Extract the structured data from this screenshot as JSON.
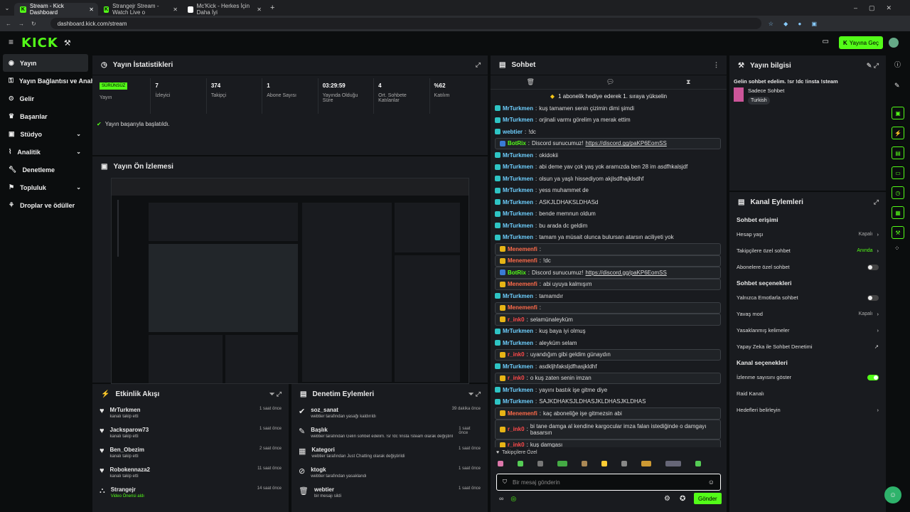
{
  "browser": {
    "tabs": [
      {
        "label": "Stream - Kick Dashboard"
      },
      {
        "label": "Strangejr Stream - Watch Live o"
      },
      {
        "label": "Mc'Kick - Herkes İçin Daha İyi"
      }
    ],
    "url": "dashboard.kick.com/stream"
  },
  "topnav": {
    "logo": "KICK",
    "go_live": "Yayına Geç"
  },
  "sidebar": {
    "items": [
      {
        "label": "Yayın"
      },
      {
        "label": "Yayın Bağlantısı ve Anahtar"
      },
      {
        "label": "Gelir"
      },
      {
        "label": "Başarılar"
      },
      {
        "label": "Stüdyo"
      },
      {
        "label": "Analitik"
      },
      {
        "label": "Denetleme"
      },
      {
        "label": "Topluluk"
      },
      {
        "label": "Droplar ve ödüller"
      }
    ]
  },
  "stats": {
    "title": "Yayın İstatistikleri",
    "badge": "SÜRÜNSÜZ",
    "badge_label": "Yayın",
    "items": [
      {
        "value": "7",
        "label": "İzleyici"
      },
      {
        "value": "374",
        "label": "Takipçi"
      },
      {
        "value": "1",
        "label": "Abone Sayısı"
      },
      {
        "value": "03:29:59",
        "label": "Yayında Olduğu Süre"
      },
      {
        "value": "4",
        "label": "Ort. Sohbete Katılanlar"
      },
      {
        "value": "%62",
        "label": "Katılım"
      }
    ],
    "success": "Yayın başarıyla başlatıldı."
  },
  "preview": {
    "title": "Yayın Ön İzlemesi"
  },
  "activity": {
    "title": "Etkinlik Akışı",
    "items": [
      {
        "name": "MrTurkmen",
        "sub": "kanalı takip etti",
        "time": "1 saat önce"
      },
      {
        "name": "Jacksparow73",
        "sub": "kanalı takip etti",
        "time": "1 saat önce"
      },
      {
        "name": "Ben_Obezim",
        "sub": "kanalı takip etti",
        "time": "2 saat önce"
      },
      {
        "name": "Robokennaza2",
        "sub": "kanalı takip etti",
        "time": "11 saat önce"
      },
      {
        "name": "Strangejr",
        "sub": "Video Önerisi aldı",
        "time": "14 saat önce"
      }
    ]
  },
  "moderation": {
    "title": "Denetim Eylemleri",
    "items": [
      {
        "name": "soz_sanat",
        "sub": "webtier tarafından yasağı kaldırıldı",
        "time": "39 dakika önce"
      },
      {
        "name": "Başlık",
        "sub": "webtier tarafından Gelin sohbet edelim. !sr !dc !insta !steam olarak değiştirildi",
        "time": "1 saat önce"
      },
      {
        "name": "Kategori",
        "sub": "webtier tarafından Just Chatting olarak değiştirildi",
        "time": "1 saat önce"
      },
      {
        "name": "ktogk",
        "sub": "webtier tarafından yasaklandı",
        "time": "1 saat önce"
      },
      {
        "name": "webtier",
        "sub": "bir mesajı sildi",
        "time": "1 saat önce"
      }
    ]
  },
  "chat": {
    "title": "Sohbet",
    "pinned": "1 abonelik hediye ederek 1. sıraya yükselin",
    "lines": [
      {
        "user": "MrTurkmen",
        "color": "#6fd0ff",
        "text": "kuş tamamen senin çizimin dimi şimdi",
        "box": false
      },
      {
        "user": "MrTurkmen",
        "color": "#6fd0ff",
        "text": "orjinali varmı görelim ya merak ettim",
        "box": false
      },
      {
        "user": "webtier",
        "color": "#6fd0ff",
        "text": "!dc",
        "box": false
      },
      {
        "user": "BotRix",
        "color": "#53fc18",
        "text": "Discord sunucumuz!",
        "link": "https://discord.gg/paKP6EomSS",
        "box": true
      },
      {
        "user": "MrTurkmen",
        "color": "#6fd0ff",
        "text": "okidokii",
        "box": false
      },
      {
        "user": "MrTurkmen",
        "color": "#6fd0ff",
        "text": "abi deme yav çok yaş yok aramızda ben 28 im asdfhkalsjdf",
        "box": false
      },
      {
        "user": "MrTurkmen",
        "color": "#6fd0ff",
        "text": "olsun ya yaşlı hissediyom akjlsdfhajklsdhf",
        "box": false
      },
      {
        "user": "MrTurkmen",
        "color": "#6fd0ff",
        "text": "yess muhammet de",
        "box": false
      },
      {
        "user": "MrTurkmen",
        "color": "#6fd0ff",
        "text": "ASKJLDHAKSLDHASd",
        "box": false
      },
      {
        "user": "MrTurkmen",
        "color": "#6fd0ff",
        "text": "bende memnun oldum",
        "box": false
      },
      {
        "user": "MrTurkmen",
        "color": "#6fd0ff",
        "text": "bu arada dc geldim",
        "box": false
      },
      {
        "user": "MrTurkmen",
        "color": "#6fd0ff",
        "text": "tamam ya müsait olunca bulursan atarsın aciliyeti yok",
        "box": false
      },
      {
        "user": "Menemenfi",
        "color": "#ff6b4a",
        "text": "",
        "box": true
      },
      {
        "user": "Menemenfi",
        "color": "#ff6b4a",
        "text": "!dc",
        "box": true
      },
      {
        "user": "BotRix",
        "color": "#53fc18",
        "text": "Discord sunucumuz!",
        "link": "https://discord.gg/paKP6EomSS",
        "box": true
      },
      {
        "user": "Menemenfi",
        "color": "#ff6b4a",
        "text": "abi uyuya kalmışım",
        "box": true
      },
      {
        "user": "MrTurkmen",
        "color": "#6fd0ff",
        "text": "tamamdır",
        "box": false
      },
      {
        "user": "Menemenfi",
        "color": "#ff6b4a",
        "text": "",
        "box": true
      },
      {
        "user": "r_ink0",
        "color": "#ff4a4a",
        "text": "selamünaleyküm",
        "box": true
      },
      {
        "user": "MrTurkmen",
        "color": "#6fd0ff",
        "text": "kuş baya iyi olmuş",
        "box": false
      },
      {
        "user": "MrTurkmen",
        "color": "#6fd0ff",
        "text": "aleyküm selam",
        "box": false
      },
      {
        "user": "r_ink0",
        "color": "#ff4a4a",
        "text": "uyandığım gibi geldim günaydın",
        "box": true
      },
      {
        "user": "MrTurkmen",
        "color": "#6fd0ff",
        "text": "asdkljhfaksljdfhasjkldhf",
        "box": false
      },
      {
        "user": "r_ink0",
        "color": "#ff4a4a",
        "text": "o kuş zaten senin imzan",
        "box": true
      },
      {
        "user": "MrTurkmen",
        "color": "#6fd0ff",
        "text": "yayını bastık işe gitme diye",
        "box": false
      },
      {
        "user": "MrTurkmen",
        "color": "#6fd0ff",
        "text": "SAJKDHAKSJLDHASJKLDHASJKLDHAS",
        "box": false
      },
      {
        "user": "Menemenfi",
        "color": "#ff6b4a",
        "text": "kaç aboneliğe işe gitmezsin abi",
        "box": true
      },
      {
        "user": "r_ink0",
        "color": "#ff4a4a",
        "text": "bi tane damga al kendine kargocular imza falan istediğinde o damgayı basarsın",
        "box": true
      },
      {
        "user": "r_ink0",
        "color": "#ff4a4a",
        "text": "kuş damgası",
        "box": true
      }
    ],
    "followers_only": "Takipçilere Özel",
    "input_placeholder": "Bir mesaj gönderin",
    "send": "Gönder"
  },
  "info": {
    "title": "Yayın bilgisi",
    "stream_title": "Gelin sohbet edelim. !sr !dc !insta !steam",
    "category": "Sadece Sohbet",
    "tag": "Turkish"
  },
  "channel": {
    "title": "Kanal Eylemleri",
    "chat_access": "Sohbet erişimi",
    "account_age": "Hesap yaşı",
    "account_age_val": "Kapalı",
    "followers_chat": "Takipçilere özel sohbet",
    "followers_chat_val": "Anında",
    "subs_chat": "Abonelere özel sohbet",
    "chat_options": "Sohbet seçenekleri",
    "emotes_only": "Yalnızca Emotlarla sohbet",
    "slow_mode": "Yavaş mod",
    "slow_mode_val": "Kapalı",
    "banned_words": "Yasaklanmış kelimeler",
    "ai_mod": "Yapay Zeka ile Sohbet Denetimi",
    "channel_options": "Kanal seçenekleri",
    "show_viewers": "İzlenme sayısını göster",
    "raid": "Raid Kanalı",
    "goals": "Hedefleri belirleyin"
  }
}
